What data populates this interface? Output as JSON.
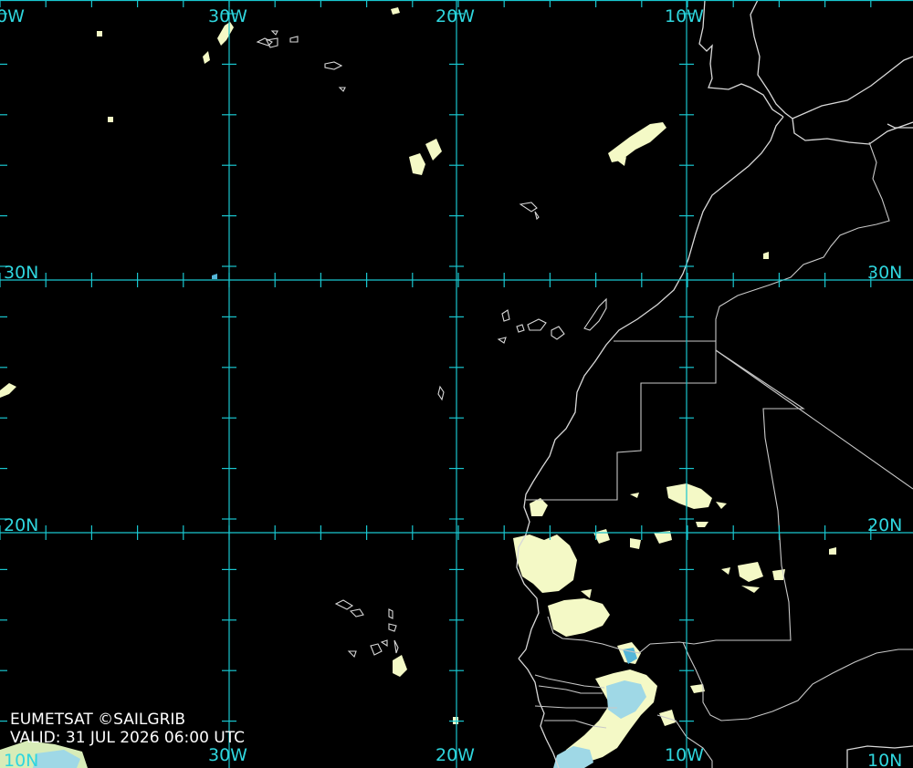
{
  "map": {
    "longitude_labels": [
      "0W",
      "30W",
      "20W",
      "10W"
    ],
    "latitude_labels": [
      "30N",
      "20N"
    ],
    "bottom_labels": [
      "10N",
      "30W",
      "20W",
      "10W",
      "10N"
    ],
    "right_labels": [
      "30N",
      "20N"
    ]
  },
  "credits": {
    "source": "EUMETSAT ©SAILGRIB",
    "valid": "VALID:  31 JUL 2026 06:00 UTC"
  },
  "colors": {
    "grid": "#19c6cf",
    "cloud": "#f4f9c6",
    "cloud_cold": "#55b6d8",
    "background": "#000000"
  }
}
